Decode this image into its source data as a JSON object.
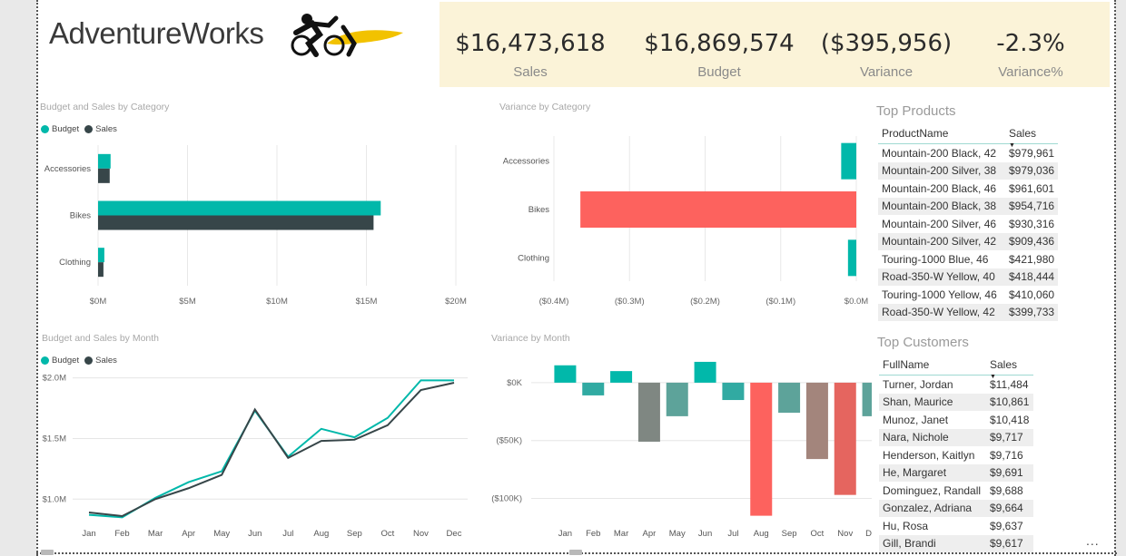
{
  "header": {
    "app_title": "AdventureWorks",
    "logo": "cyclist-logo"
  },
  "kpis": [
    {
      "value": "$16,473,618",
      "label": "Sales"
    },
    {
      "value": "$16,869,574",
      "label": "Budget"
    },
    {
      "value": "($395,956)",
      "label": "Variance"
    },
    {
      "value": "-2.3%",
      "label": "Variance%"
    }
  ],
  "colors": {
    "budget": "#01b8aa",
    "sales": "#374649",
    "negative": "#fd625e",
    "kpi_bg": "#fbf3d8"
  },
  "chart_data": [
    {
      "id": "budget_sales_category",
      "type": "bar",
      "title": "Budget and Sales by Category",
      "categories": [
        "Accessories",
        "Bikes",
        "Clothing"
      ],
      "series": [
        {
          "name": "Budget",
          "values": [
            0.7,
            15.8,
            0.35
          ]
        },
        {
          "name": "Sales",
          "values": [
            0.65,
            15.4,
            0.3
          ]
        }
      ],
      "xticks": [
        "$0M",
        "$5M",
        "$10M",
        "$15M",
        "$20M"
      ],
      "xlim": [
        0,
        20
      ],
      "unit": "millions",
      "legend_position": "top-left"
    },
    {
      "id": "variance_category",
      "type": "bar",
      "title": "Variance by Category",
      "categories": [
        "Accessories",
        "Bikes",
        "Clothing"
      ],
      "values": [
        -0.02,
        -0.365,
        -0.011
      ],
      "xticks": [
        "($0.4M)",
        "($0.3M)",
        "($0.2M)",
        "($0.1M)",
        "$0.0M"
      ],
      "xlim": [
        -0.4,
        0
      ],
      "unit": "millions"
    },
    {
      "id": "budget_sales_month",
      "type": "line",
      "title": "Budget and Sales by Month",
      "categories": [
        "Jan",
        "Feb",
        "Mar",
        "Apr",
        "May",
        "Jun",
        "Jul",
        "Aug",
        "Sep",
        "Oct",
        "Nov",
        "Dec"
      ],
      "series": [
        {
          "name": "Budget",
          "values": [
            0.87,
            0.85,
            1.01,
            1.14,
            1.23,
            1.73,
            1.35,
            1.58,
            1.51,
            1.67,
            1.98,
            1.98
          ]
        },
        {
          "name": "Sales",
          "values": [
            0.89,
            0.86,
            1.0,
            1.09,
            1.2,
            1.74,
            1.34,
            1.48,
            1.49,
            1.61,
            1.9,
            1.96
          ]
        }
      ],
      "yticks": [
        "$1.0M",
        "$1.5M",
        "$2.0M"
      ],
      "ylim": [
        0.8,
        2.05
      ],
      "unit": "millions",
      "legend_position": "top-left"
    },
    {
      "id": "variance_month",
      "type": "bar",
      "title": "Variance by Month",
      "categories": [
        "Jan",
        "Feb",
        "Mar",
        "Apr",
        "May",
        "Jun",
        "Jul",
        "Aug",
        "Sep",
        "Oct",
        "Nov",
        "Dec"
      ],
      "values": [
        15,
        -11,
        10,
        -51,
        -29,
        18,
        -15,
        -115,
        -26,
        -66,
        -97,
        -29
      ],
      "bar_colors": [
        "#01b8aa",
        "#31aaa2",
        "#01b8aa",
        "#7f8782",
        "#5da39a",
        "#01b8aa",
        "#31aaa2",
        "#fd625e",
        "#5da39a",
        "#a3857c",
        "#e5655f",
        "#5da39a"
      ],
      "yticks": [
        "$0K",
        "($50K)",
        "($100K)"
      ],
      "ylim": [
        -120,
        25
      ],
      "unit": "thousands"
    }
  ],
  "top_products": {
    "title": "Top Products",
    "columns": [
      "ProductName",
      "Sales"
    ],
    "rows": [
      [
        "Mountain-200 Black, 42",
        "$979,961"
      ],
      [
        "Mountain-200 Silver, 38",
        "$979,036"
      ],
      [
        "Mountain-200 Black, 46",
        "$961,601"
      ],
      [
        "Mountain-200 Black, 38",
        "$954,716"
      ],
      [
        "Mountain-200 Silver, 46",
        "$930,316"
      ],
      [
        "Mountain-200 Silver, 42",
        "$909,436"
      ],
      [
        "Touring-1000 Blue, 46",
        "$421,980"
      ],
      [
        "Road-350-W Yellow, 40",
        "$418,444"
      ],
      [
        "Touring-1000 Yellow, 46",
        "$410,060"
      ],
      [
        "Road-350-W Yellow, 42",
        "$399,733"
      ]
    ]
  },
  "top_customers": {
    "title": "Top Customers",
    "columns": [
      "FullName",
      "Sales"
    ],
    "rows": [
      [
        "Turner, Jordan",
        "$11,484"
      ],
      [
        "Shan, Maurice",
        "$10,861"
      ],
      [
        "Munoz, Janet",
        "$10,418"
      ],
      [
        "Nara, Nichole",
        "$9,717"
      ],
      [
        "Henderson, Kaitlyn",
        "$9,716"
      ],
      [
        "He, Margaret",
        "$9,691"
      ],
      [
        "Dominguez, Randall",
        "$9,688"
      ],
      [
        "Gonzalez, Adriana",
        "$9,664"
      ],
      [
        "Hu, Rosa",
        "$9,637"
      ],
      [
        "Gill, Brandi",
        "$9,617"
      ]
    ]
  },
  "more_options": "..."
}
